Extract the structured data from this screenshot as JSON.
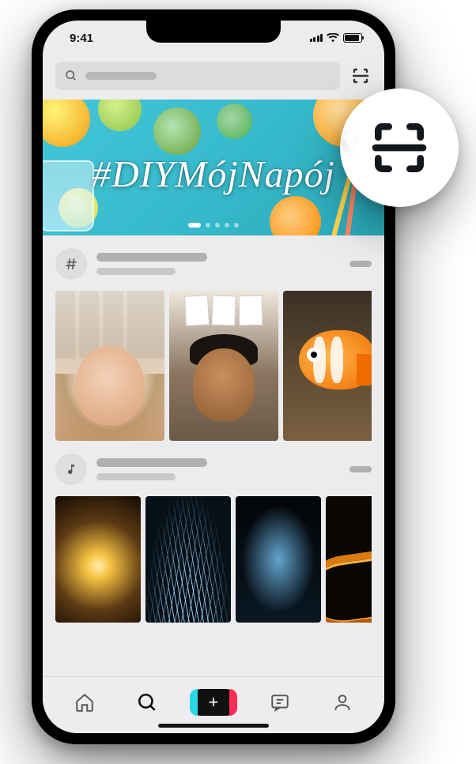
{
  "status": {
    "time": "9:41"
  },
  "search": {
    "placeholder": ""
  },
  "banner": {
    "hashtag": "#DIYMójNapój"
  },
  "sections": [
    {
      "icon": "hashtag"
    },
    {
      "icon": "music-note"
    }
  ],
  "nav": {
    "items": [
      "home",
      "discover",
      "create",
      "inbox",
      "profile"
    ],
    "active": "discover"
  }
}
